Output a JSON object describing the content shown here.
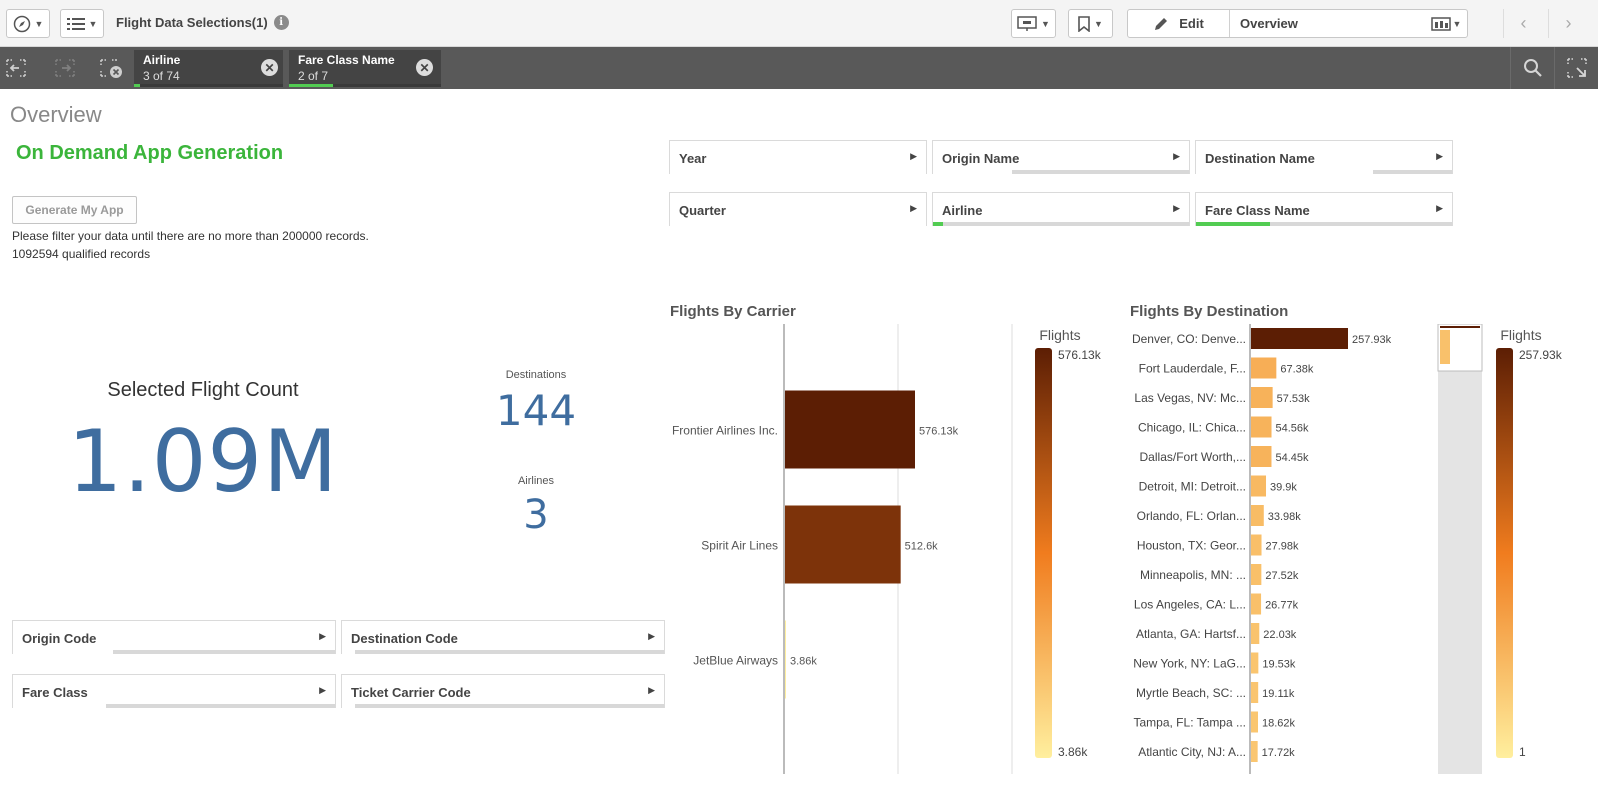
{
  "toolbar": {
    "app_title": "Flight Data Selections(1)",
    "info_glyph": "i",
    "nav_icon": "compass-icon",
    "list_icon": "list-icon",
    "present_icon": "presentation-icon",
    "bookmark_icon": "bookmark-icon",
    "edit_label": "Edit",
    "sheet_name": "Overview",
    "sheets_icon": "sheets-icon",
    "prev_glyph": "‹",
    "next_glyph": "›"
  },
  "selections": {
    "chips": [
      {
        "field": "Airline",
        "count": "3 of 74",
        "fill": 0.04
      },
      {
        "field": "Fare Class Name",
        "count": "2 of 7",
        "fill": 0.29
      }
    ]
  },
  "sheet": {
    "title": "Overview",
    "ondemand_title": "On Demand App Generation",
    "generate_button": "Generate My App",
    "filter_message": "Please filter your data until there are no more than 200000 records.",
    "qualified_message": "1092594 qualified records"
  },
  "kpis": {
    "main_label": "Selected Flight Count",
    "main_value": "1.09M",
    "destinations_label": "Destinations",
    "destinations_value": "144",
    "airlines_label": "Airlines",
    "airlines_value": "3"
  },
  "filter_panes": {
    "top": [
      {
        "label": "Year",
        "selected_fraction": 0,
        "possible_fraction": 1
      },
      {
        "label": "Origin Name",
        "selected_fraction": 0,
        "possible_fraction": 0.31
      },
      {
        "label": "Destination Name",
        "selected_fraction": 0,
        "possible_fraction": 0.69
      },
      {
        "label": "Quarter",
        "selected_fraction": 0,
        "possible_fraction": 1
      },
      {
        "label": "Airline",
        "selected_fraction": 0.04,
        "possible_fraction": 0.04
      },
      {
        "label": "Fare Class Name",
        "selected_fraction": 0.29,
        "possible_fraction": 0.29
      }
    ],
    "bottom": [
      {
        "label": "Origin Code",
        "selected_fraction": 0,
        "possible_fraction": 0.31
      },
      {
        "label": "Destination Code",
        "selected_fraction": 0,
        "possible_fraction": 0.04
      },
      {
        "label": "Fare Class",
        "selected_fraction": 0,
        "possible_fraction": 0.29
      },
      {
        "label": "Ticket Carrier Code",
        "selected_fraction": 0,
        "possible_fraction": 0.04
      }
    ]
  },
  "chart_data": [
    {
      "type": "bar",
      "orientation": "horizontal",
      "title": "Flights By Carrier",
      "categories": [
        "Frontier Airlines Inc.",
        "Spirit Air Lines",
        "JetBlue Airways"
      ],
      "values": [
        576130,
        512600,
        3860
      ],
      "value_labels": [
        "576.13k",
        "512.6k",
        "3.86k"
      ],
      "legend": {
        "title": "Flights",
        "max_label": "576.13k",
        "min_label": "3.86k",
        "placement": "right"
      },
      "colors": {
        "high": "#5c1e04",
        "mid": "#f07c1e",
        "low": "#ffef9e"
      }
    },
    {
      "type": "bar",
      "orientation": "horizontal",
      "title": "Flights By Destination",
      "categories": [
        "Denver, CO: Denve...",
        "Fort Lauderdale, F...",
        "Las Vegas, NV: Mc...",
        "Chicago, IL: Chica...",
        "Dallas/Fort Worth,...",
        "Detroit, MI: Detroit...",
        "Orlando, FL: Orlan...",
        "Houston, TX: Geor...",
        "Minneapolis, MN: ...",
        "Los Angeles, CA: L...",
        "Atlanta, GA: Hartsf...",
        "New York, NY: LaG...",
        "Myrtle Beach, SC: ...",
        "Tampa, FL: Tampa ...",
        "Atlantic City, NJ: A..."
      ],
      "values": [
        257930,
        67380,
        57530,
        54560,
        54450,
        39900,
        33980,
        27980,
        27520,
        26770,
        22030,
        19530,
        19110,
        18620,
        17720
      ],
      "value_labels": [
        "257.93k",
        "67.38k",
        "57.53k",
        "54.56k",
        "54.45k",
        "39.9k",
        "33.98k",
        "27.98k",
        "27.52k",
        "26.77k",
        "22.03k",
        "19.53k",
        "19.11k",
        "18.62k",
        "17.72k"
      ],
      "legend": {
        "title": "Flights",
        "max_label": "257.93k",
        "min_label": "1",
        "placement": "right"
      },
      "colors": {
        "high": "#5c1e04",
        "mid": "#f07c1e",
        "low": "#ffef9e"
      }
    }
  ]
}
